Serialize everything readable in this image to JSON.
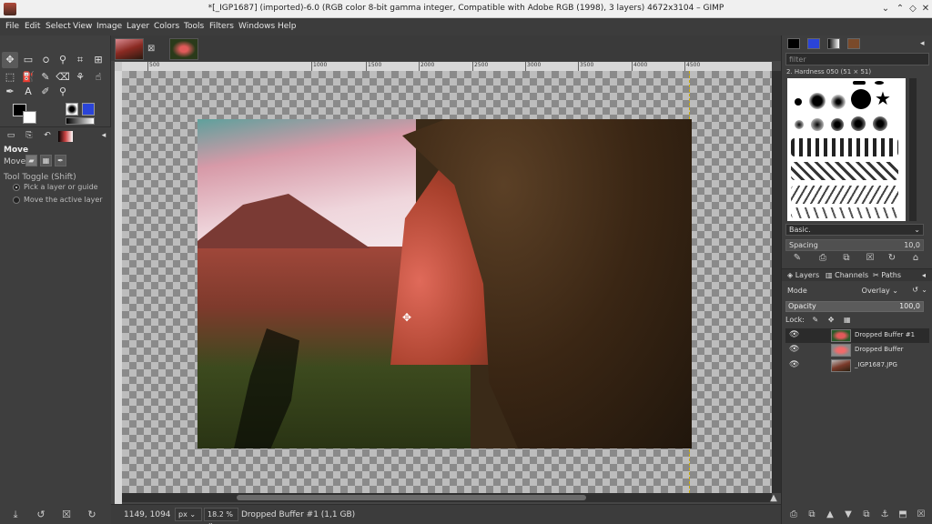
{
  "window": {
    "title": "*[_IGP1687] (imported)-6.0 (RGB color 8-bit gamma integer, Compatible with Adobe RGB (1998), 3 layers) 4672x3104 – GIMP"
  },
  "menu": [
    "File",
    "Edit",
    "Select",
    "View",
    "Image",
    "Layer",
    "Colors",
    "Tools",
    "Filters",
    "Windows",
    "Help"
  ],
  "toolbox": {
    "tool_options_title": "Move",
    "move_label": "Move:",
    "tool_toggle": "Tool Toggle  (Shift)",
    "options": [
      {
        "label": "Pick a layer or guide",
        "selected": true
      },
      {
        "label": "Move the active layer",
        "selected": false
      }
    ],
    "fg_color": "#000000",
    "bg_color": "#ffffff"
  },
  "canvas": {
    "ruler_ticks": [
      "500",
      "1000",
      "1500",
      "2000",
      "2500",
      "3000",
      "3500",
      "4000",
      "4500"
    ]
  },
  "status": {
    "coords": "1149, 1094",
    "unit": "px",
    "zoom": "18.2 %",
    "message": "Dropped Buffer #1 (1,1 GB)"
  },
  "brushes": {
    "filter_placeholder": "filter",
    "current_brush": "2. Hardness 050 (51 × 51)",
    "tag": "Basic.",
    "spacing_label": "Spacing",
    "spacing_value": "10,0"
  },
  "layers_panel": {
    "tabs": [
      "Layers",
      "Channels",
      "Paths"
    ],
    "mode_label": "Mode",
    "mode_value": "Overlay",
    "opacity_label": "Opacity",
    "opacity_value": "100,0",
    "lock_label": "Lock:",
    "layers": [
      {
        "name": "Dropped Buffer #1",
        "selected": true
      },
      {
        "name": "Dropped Buffer",
        "selected": false
      },
      {
        "name": "_IGP1687.JPG",
        "selected": false
      }
    ]
  }
}
